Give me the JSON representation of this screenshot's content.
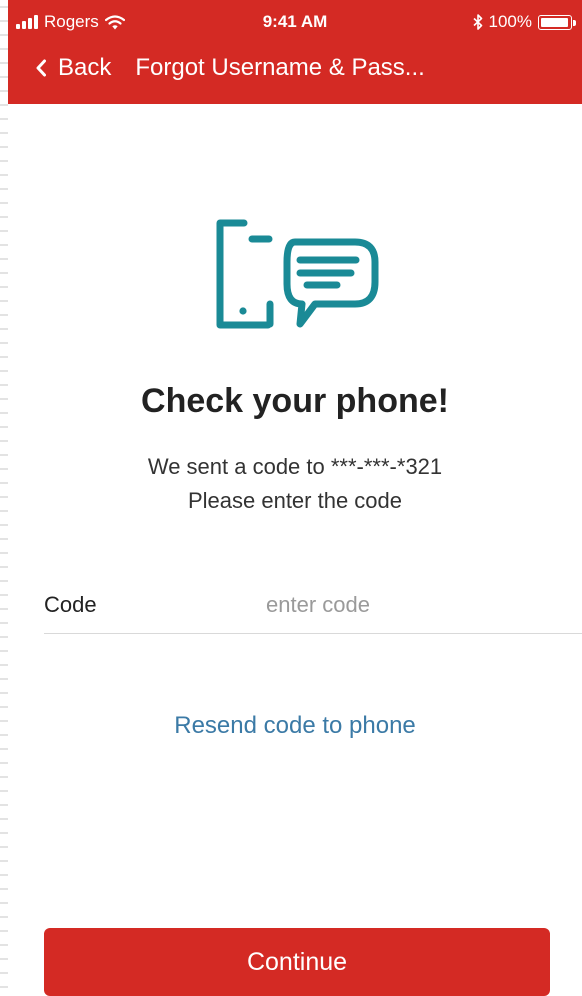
{
  "colors": {
    "brand_red": "#d42a24",
    "icon_teal": "#1a8a96",
    "link_blue": "#3b7aa6"
  },
  "status_bar": {
    "carrier": "Rogers",
    "time": "9:41 AM",
    "battery": "100%",
    "icons": [
      "signal-icon",
      "wifi-icon",
      "bluetooth-icon",
      "battery-icon"
    ]
  },
  "nav": {
    "back_label": "Back",
    "title": "Forgot Username & Pass..."
  },
  "main": {
    "icon": "phone-message-icon",
    "title": "Check your phone!",
    "subtitle_line1": "We sent a code to ***-***-*321",
    "subtitle_line2": "Please enter the code"
  },
  "form": {
    "code_label": "Code",
    "code_placeholder": "enter code",
    "code_value": ""
  },
  "resend_label": "Resend code to phone",
  "continue_label": "Continue"
}
